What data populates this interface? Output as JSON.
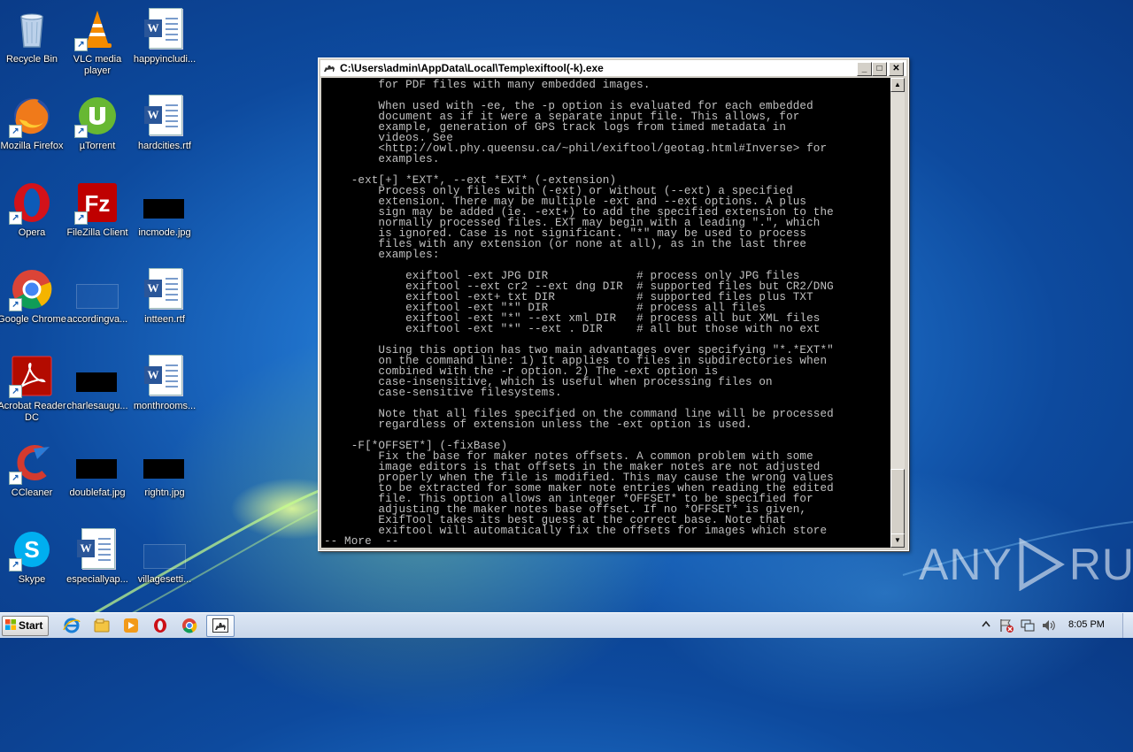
{
  "desktop": {
    "icons": [
      {
        "label": "Recycle Bin",
        "icon": "recycle-bin-icon"
      },
      {
        "label": "VLC media player",
        "icon": "vlc-icon"
      },
      {
        "label": "happyincludi...",
        "icon": "word-document-icon"
      },
      {
        "label": "Mozilla Firefox",
        "icon": "firefox-icon"
      },
      {
        "label": "µTorrent",
        "icon": "utorrent-icon"
      },
      {
        "label": "hardcities.rtf",
        "icon": "word-document-icon"
      },
      {
        "label": "Opera",
        "icon": "opera-icon"
      },
      {
        "label": "FileZilla Client",
        "icon": "filezilla-icon"
      },
      {
        "label": "incmode.jpg",
        "icon": "image-file-icon"
      },
      {
        "label": "Google Chrome",
        "icon": "chrome-icon"
      },
      {
        "label": "accordingva...",
        "icon": "image-file-icon"
      },
      {
        "label": "intteen.rtf",
        "icon": "word-document-icon"
      },
      {
        "label": "Acrobat Reader DC",
        "icon": "acrobat-icon"
      },
      {
        "label": "charlesaugu...",
        "icon": "image-file-icon"
      },
      {
        "label": "monthrooms...",
        "icon": "word-document-icon"
      },
      {
        "label": "CCleaner",
        "icon": "ccleaner-icon"
      },
      {
        "label": "doublefat.jpg",
        "icon": "image-file-icon"
      },
      {
        "label": "rightn.jpg",
        "icon": "image-file-icon"
      },
      {
        "label": "Skype",
        "icon": "skype-icon"
      },
      {
        "label": "especiallyap...",
        "icon": "word-document-icon"
      },
      {
        "label": "villagesetti...",
        "icon": "image-file-icon"
      }
    ]
  },
  "console_window": {
    "title": "C:\\Users\\admin\\AppData\\Local\\Temp\\exiftool(-k).exe",
    "buttons": {
      "minimize": "_",
      "maximize": "□",
      "close": "✕"
    },
    "lines": [
      "        for PDF files with many embedded images.",
      "",
      "        When used with -ee, the -p option is evaluated for each embedded",
      "        document as if it were a separate input file. This allows, for",
      "        example, generation of GPS track logs from timed metadata in",
      "        videos. See",
      "        <http://owl.phy.queensu.ca/~phil/exiftool/geotag.html#Inverse> for",
      "        examples.",
      "",
      "    -ext[+] *EXT*, --ext *EXT* (-extension)",
      "        Process only files with (-ext) or without (--ext) a specified",
      "        extension. There may be multiple -ext and --ext options. A plus",
      "        sign may be added (ie. -ext+) to add the specified extension to the",
      "        normally processed files. EXT may begin with a leading \".\", which",
      "        is ignored. Case is not significant. \"*\" may be used to process",
      "        files with any extension (or none at all), as in the last three",
      "        examples:",
      "",
      "            exiftool -ext JPG DIR             # process only JPG files",
      "            exiftool --ext cr2 --ext dng DIR  # supported files but CR2/DNG",
      "            exiftool -ext+ txt DIR            # supported files plus TXT",
      "            exiftool -ext \"*\" DIR             # process all files",
      "            exiftool -ext \"*\" --ext xml DIR   # process all but XML files",
      "            exiftool -ext \"*\" --ext . DIR     # all but those with no ext",
      "",
      "        Using this option has two main advantages over specifying \"*.*EXT*\"",
      "        on the command line: 1) It applies to files in subdirectories when",
      "        combined with the -r option. 2) The -ext option is",
      "        case-insensitive, which is useful when processing files on",
      "        case-sensitive filesystems.",
      "",
      "        Note that all files specified on the command line will be processed",
      "        regardless of extension unless the -ext option is used.",
      "",
      "    -F[*OFFSET*] (-fixBase)",
      "        Fix the base for maker notes offsets. A common problem with some",
      "        image editors is that offsets in the maker notes are not adjusted",
      "        properly when the file is modified. This may cause the wrong values",
      "        to be extracted for some maker note entries when reading the edited",
      "        file. This option allows an integer *OFFSET* to be specified for",
      "        adjusting the maker notes base offset. If no *OFFSET* is given,",
      "        ExifTool takes its best guess at the correct base. Note that",
      "        exiftool will automatically fix the offsets for images which store",
      "-- More  --"
    ]
  },
  "taskbar": {
    "start_label": "Start",
    "pinned": [
      "internet-explorer-icon",
      "windows-explorer-icon",
      "media-player-icon",
      "opera-icon",
      "chrome-icon",
      "exiftool-icon"
    ],
    "clock": "8:05 PM"
  },
  "watermark": {
    "left": "ANY",
    "right": "RUN"
  }
}
